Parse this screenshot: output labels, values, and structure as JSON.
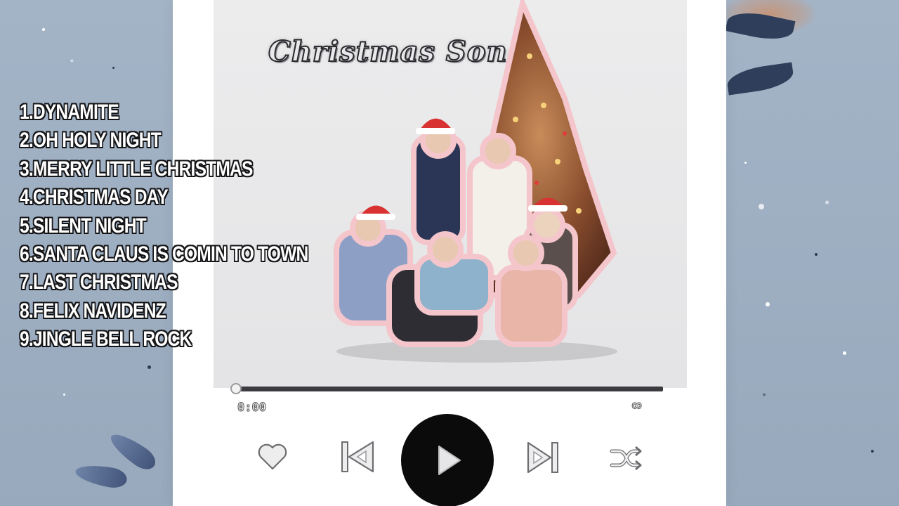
{
  "cover": {
    "title": "Christmas Song"
  },
  "tracklist": {
    "items": [
      "1.DYNAMITE",
      "2.OH HOLY NIGHT",
      "3.MERRY LITTLE CHRISTMAS",
      "4.CHRISTMAS DAY",
      "5.SILENT NIGHT",
      "6.SANTA CLAUS IS COMIN TO TOWN",
      "7.LAST CHRISTMAS",
      "8.FELIX NAVIDENZ",
      "9.JINGLE BELL ROCK"
    ]
  },
  "player": {
    "current_time": "0:00",
    "total_time": "∞",
    "progress_fraction": 0,
    "controls": {
      "like": "heart-icon",
      "previous": "skip-back-icon",
      "play": "play-icon",
      "next": "skip-forward-icon",
      "shuffle": "shuffle-icon"
    }
  },
  "colors": {
    "background": "#9fb0c4",
    "card": "#ffffff",
    "cover": "#e8e8ea",
    "play_button": "#0b0b0c",
    "track_text": "#ffffff",
    "track_outline": "#151517"
  }
}
